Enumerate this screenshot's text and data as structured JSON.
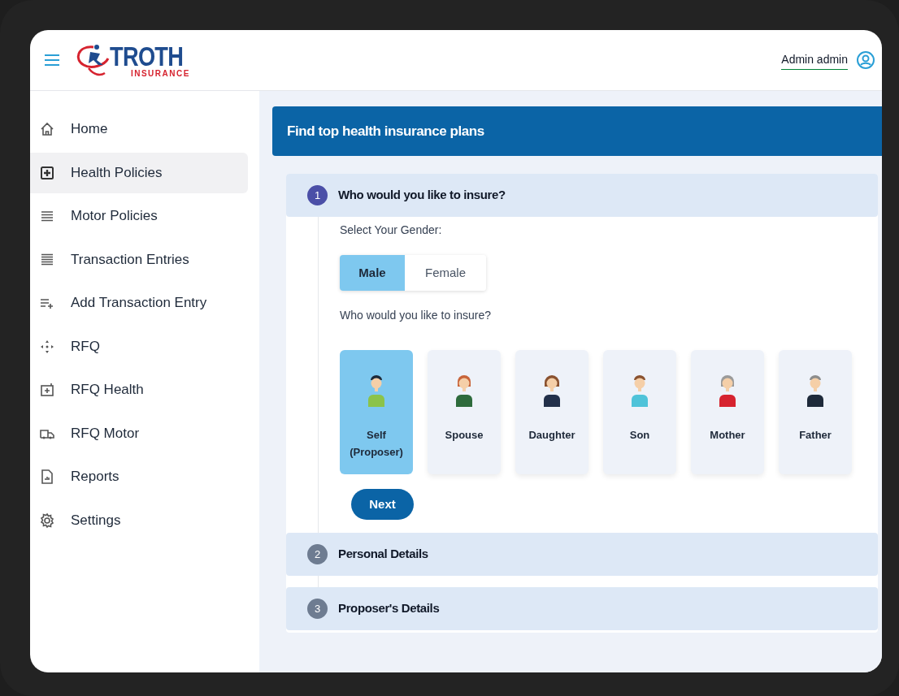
{
  "header": {
    "logo": {
      "name": "TROTH",
      "tagline": "INSURANCE"
    },
    "user": "Admin admin"
  },
  "sidebar": {
    "items": [
      {
        "label": "Home",
        "selected": false
      },
      {
        "label": "Health Policies",
        "selected": true
      },
      {
        "label": "Motor Policies",
        "selected": false
      },
      {
        "label": "Transaction Entries",
        "selected": false
      },
      {
        "label": "Add Transaction Entry",
        "selected": false
      },
      {
        "label": "RFQ",
        "selected": false
      },
      {
        "label": "RFQ Health",
        "selected": false
      },
      {
        "label": "RFQ Motor",
        "selected": false
      },
      {
        "label": "Reports",
        "selected": false
      },
      {
        "label": "Settings",
        "selected": false
      }
    ]
  },
  "banner": {
    "title": "Find top health insurance plans"
  },
  "steps": [
    {
      "number": "1",
      "title": "Who would you like to insure?",
      "expanded": true
    },
    {
      "number": "2",
      "title": "Personal Details",
      "expanded": false
    },
    {
      "number": "3",
      "title": "Proposer's Details",
      "expanded": false
    }
  ],
  "gender": {
    "label": "Select Your Gender:",
    "options": [
      {
        "label": "Male",
        "selected": true
      },
      {
        "label": "Female",
        "selected": false
      }
    ]
  },
  "members": {
    "label": "Who would you like to insure?",
    "options": [
      {
        "label": "Self (Proposer)",
        "selected": true
      },
      {
        "label": "Spouse",
        "selected": false
      },
      {
        "label": "Daughter",
        "selected": false
      },
      {
        "label": "Son",
        "selected": false
      },
      {
        "label": "Mother",
        "selected": false
      },
      {
        "label": "Father",
        "selected": false
      }
    ]
  },
  "next_button": {
    "label": "Next"
  }
}
